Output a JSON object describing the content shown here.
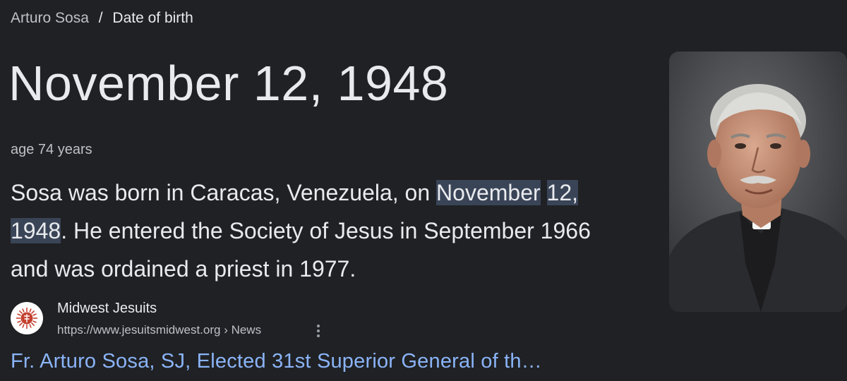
{
  "breadcrumb": {
    "entity": "Arturo Sosa",
    "separator": "/",
    "attribute": "Date of birth"
  },
  "answer": {
    "value": "November 12, 1948",
    "subtext": "age 74 years"
  },
  "snippet": {
    "before": "Sosa was born in Caracas, Venezuela, on ",
    "highlight_line1": "November",
    "highlight_line2": "12, 1948",
    "after": ". He entered the Society of Jesus in September 1966 and was ordained a priest in 1977."
  },
  "source": {
    "name": "Midwest Jesuits",
    "url": "https://www.jesuitsmidwest.org › News",
    "favicon_icon": "jesuit-seal-icon",
    "menu_icon": "more-vert-icon"
  },
  "result": {
    "title": "Fr. Arturo Sosa, SJ, Elected 31st Superior General of th…"
  },
  "colors": {
    "background": "#202124",
    "text_primary": "#e8eaed",
    "text_secondary": "#bdc1c6",
    "link": "#8ab4f8",
    "highlight": "#394457"
  }
}
